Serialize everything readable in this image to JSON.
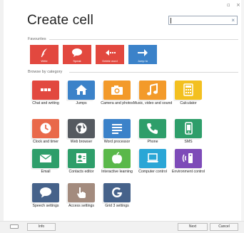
{
  "title": "Create cell",
  "search": {
    "value": "",
    "clear_glyph": "×"
  },
  "favourites": {
    "heading": "Favourites",
    "items": [
      {
        "label": "Write",
        "icon": "quill-icon",
        "color": "#e2483f"
      },
      {
        "label": "Speak",
        "icon": "speech-bubble-icon",
        "color": "#e2483f"
      },
      {
        "label": "Delete word",
        "icon": "delete-word-icon",
        "color": "#e2483f"
      },
      {
        "label": "Jump to",
        "icon": "arrow-right-icon",
        "color": "#3b82c9"
      }
    ]
  },
  "browse": {
    "heading": "Browse by category"
  },
  "categories": [
    {
      "label": "Chat and writing",
      "icon": "ellipsis-icon",
      "color": "#e2483f"
    },
    {
      "label": "Jumps",
      "icon": "home-icon",
      "color": "#3b82c9"
    },
    {
      "label": "Camera and photos",
      "icon": "camera-icon",
      "color": "#f39a2a"
    },
    {
      "label": "Music, video and sound",
      "icon": "music-note-icon",
      "color": "#f39a2a"
    },
    {
      "label": "Calculator",
      "icon": "calculator-icon",
      "color": "#f3c020"
    },
    {
      "label": "Clock and timer",
      "icon": "clock-icon",
      "color": "#e9694a"
    },
    {
      "label": "Web browser",
      "icon": "globe-icon",
      "color": "#555a60"
    },
    {
      "label": "Word processor",
      "icon": "text-lines-icon",
      "color": "#3b82c9"
    },
    {
      "label": "Phone",
      "icon": "phone-icon",
      "color": "#2e9e6a"
    },
    {
      "label": "SMS",
      "icon": "mobile-phone-icon",
      "color": "#2e9e6a"
    },
    {
      "label": "Email",
      "icon": "envelope-icon",
      "color": "#2e9e6a"
    },
    {
      "label": "Contacts editor",
      "icon": "contact-card-icon",
      "color": "#2e9e6a"
    },
    {
      "label": "Interactive learning",
      "icon": "apple-icon",
      "color": "#5ab84a"
    },
    {
      "label": "Computer control",
      "icon": "laptop-icon",
      "color": "#2aa6d6"
    },
    {
      "label": "Environment control",
      "icon": "remote-signal-icon",
      "color": "#7d4bb8"
    },
    {
      "label": "Speech settings",
      "icon": "speech-bubble-icon",
      "color": "#46628a"
    },
    {
      "label": "Access settings",
      "icon": "pointing-hand-icon",
      "color": "#a38b7e"
    },
    {
      "label": "Grid 3 settings",
      "icon": "grid3-logo-icon",
      "color": "#46628a"
    }
  ],
  "buttons": {
    "info": "Info",
    "next": "Next",
    "cancel": "Cancel"
  }
}
